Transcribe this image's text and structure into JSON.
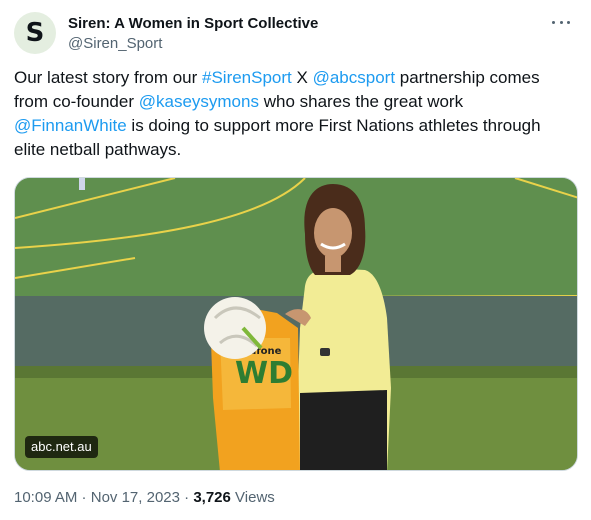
{
  "account": {
    "display_name": "Siren: A Women in Sport Collective",
    "handle": "@Siren_Sport",
    "avatar_letter": "S"
  },
  "tweet": {
    "text_parts": [
      "Our latest story from our ",
      "#SirenSport",
      " X ",
      "@abcsport",
      " partnership comes from co-founder ",
      "@kaseysymons",
      " who shares the great work ",
      "@FinnanWhite",
      " is doing to support more First Nations athletes through elite netball pathways."
    ],
    "media": {
      "source_label": "abc.net.au",
      "bib_text": "WD",
      "bib_sponsor": "vodafone"
    }
  },
  "meta": {
    "time": "10:09 AM",
    "separator": " · ",
    "date": "Nov 17, 2023",
    "views_count": "3,726",
    "views_label": "Views"
  },
  "colors": {
    "link": "#1d9bf0",
    "text": "#0f1419",
    "secondary": "#536471"
  }
}
